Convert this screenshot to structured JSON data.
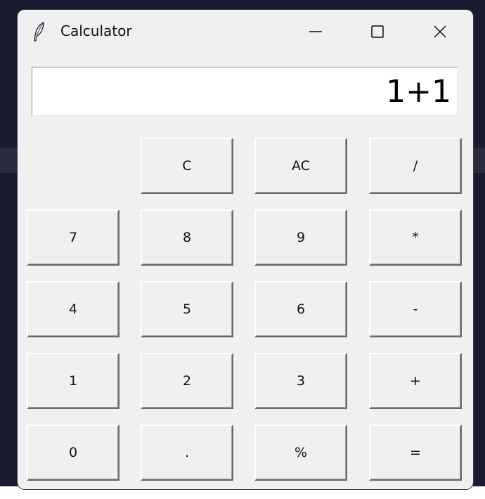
{
  "window": {
    "title": "Calculator",
    "icon": "feather-icon",
    "controls": {
      "minimize_icon": "minimize-icon",
      "maximize_icon": "maximize-icon",
      "close_icon": "close-icon"
    }
  },
  "display": {
    "value": "1+1"
  },
  "keys": {
    "clear": "C",
    "all_clear": "AC",
    "divide": "/",
    "seven": "7",
    "eight": "8",
    "nine": "9",
    "multiply": "*",
    "four": "4",
    "five": "5",
    "six": "6",
    "subtract": "-",
    "one": "1",
    "two": "2",
    "three": "3",
    "add": "+",
    "zero": "0",
    "decimal": ".",
    "percent": "%",
    "equals": "="
  },
  "colors": {
    "window_bg": "#f0f0f0",
    "display_bg": "#ffffff",
    "desktop_bg": "#1a1b2e",
    "feather_icon": "#3b6ea8"
  }
}
